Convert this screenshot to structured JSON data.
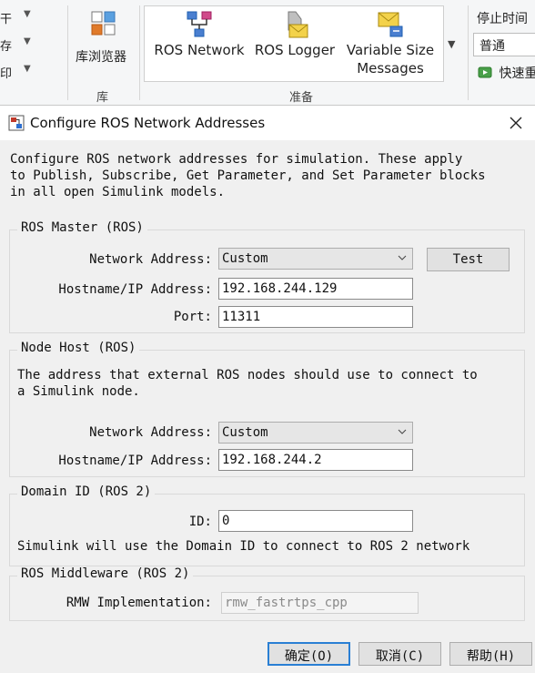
{
  "ribbon": {
    "left_items": [
      "干",
      "存",
      "印"
    ],
    "library_button": "库浏览器",
    "library_group": "库",
    "gallery": [
      {
        "label": "ROS Network",
        "icon": "ros-network-icon"
      },
      {
        "label": "ROS Logger",
        "icon": "ros-logger-icon"
      },
      {
        "label": "Variable Size Messages",
        "icon": "variable-size-messages-icon"
      }
    ],
    "prepare_group": "准备",
    "stop_time_label": "停止时间",
    "mode_value": "普通",
    "quick_label": "快速重"
  },
  "dialog": {
    "title": "Configure ROS Network Addresses",
    "intro": "Configure ROS network addresses for simulation. These apply\nto Publish, Subscribe, Get Parameter, and Set Parameter blocks\nin all open Simulink models.",
    "ros_master": {
      "title": "ROS Master (ROS)",
      "network_address_label": "Network Address:",
      "network_address_value": "Custom",
      "test_button": "Test",
      "hostname_label": "Hostname/IP Address:",
      "hostname_value": "192.168.244.129",
      "port_label": "Port:",
      "port_value": "11311"
    },
    "node_host": {
      "title": "Node Host (ROS)",
      "description": "The address that external ROS nodes should use to connect to\na Simulink node.",
      "network_address_label": "Network Address:",
      "network_address_value": "Custom",
      "hostname_label": "Hostname/IP Address:",
      "hostname_value": "192.168.244.2"
    },
    "domain_id": {
      "title": "Domain ID (ROS 2)",
      "id_label": "ID:",
      "id_value": "0",
      "description": "Simulink will use the Domain ID to connect to ROS 2 network"
    },
    "middleware": {
      "title": "ROS Middleware (ROS 2)",
      "rmw_label": "RMW Implementation:",
      "rmw_value": "rmw_fastrtps_cpp"
    },
    "buttons": {
      "ok": "确定(O)",
      "cancel": "取消(C)",
      "help": "帮助(H)"
    }
  },
  "colors": {
    "accent": "#2a7fd4",
    "ros_blue": "#1f5fb0",
    "envelope_yellow": "#f3d24a"
  }
}
